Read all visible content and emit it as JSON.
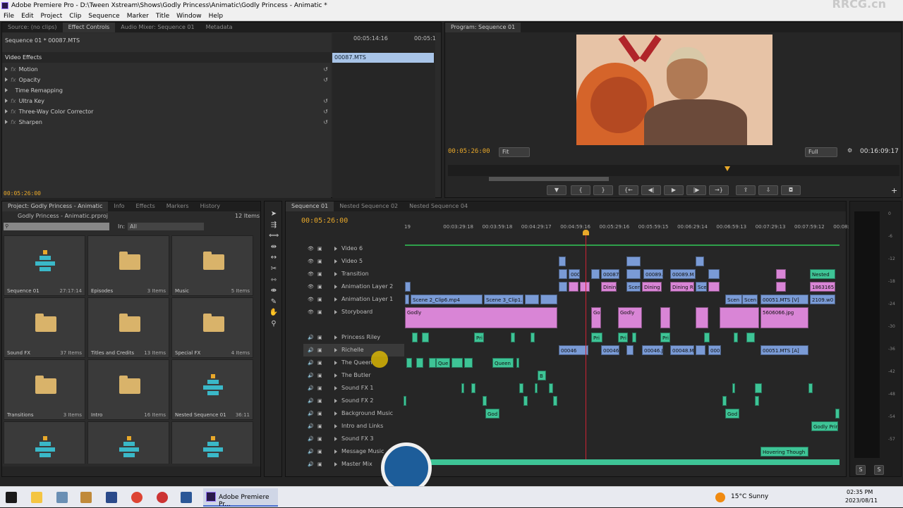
{
  "title": "Adobe Premiere Pro - D:\\Tween Xstream\\Shows\\Godly Princess\\Animatic\\Godly Princess - Animatic *",
  "watermark": "RRCG.cn",
  "menu": [
    "File",
    "Edit",
    "Project",
    "Clip",
    "Sequence",
    "Marker",
    "Title",
    "Window",
    "Help"
  ],
  "source_tabs": [
    "Source: (no clips)",
    "Effect Controls",
    "Audio Mixer: Sequence 01",
    "Metadata"
  ],
  "effect_controls": {
    "header": "Sequence 01 * 00087.MTS",
    "tc1": "00:05:14:16",
    "tc2": "00:05:1",
    "clip": "00087.MTS",
    "section": "Video Effects",
    "effects": [
      "Motion",
      "Opacity",
      "Time Remapping",
      "Ultra Key",
      "Three-Way Color Corrector",
      "Sharpen"
    ],
    "footer_tc": "00:05:26:00"
  },
  "program": {
    "tab": "Program: Sequence 01",
    "tc": "00:05:26:00",
    "fit": "Fit",
    "full": "Full",
    "duration": "00:16:09:17"
  },
  "project": {
    "tabs": [
      "Project: Godly Princess - Animatic",
      "Info",
      "Effects",
      "Markers",
      "History"
    ],
    "file": "Godly Princess - Animatic.prproj",
    "count": "12 Items",
    "in_label": "In:",
    "in_value": "All",
    "items": [
      {
        "name": "Sequence 01",
        "meta": "27:17:14",
        "kind": "seq"
      },
      {
        "name": "Episodes",
        "meta": "3 Items",
        "kind": "folder"
      },
      {
        "name": "Music",
        "meta": "5 Items",
        "kind": "folder"
      },
      {
        "name": "Sound FX",
        "meta": "37 Items",
        "kind": "folder"
      },
      {
        "name": "Titles and Credits",
        "meta": "13 Items",
        "kind": "folder"
      },
      {
        "name": "Special FX",
        "meta": "4 Items",
        "kind": "folder"
      },
      {
        "name": "Transitions",
        "meta": "3 Items",
        "kind": "folder"
      },
      {
        "name": "Intro",
        "meta": "16 Items",
        "kind": "folder"
      },
      {
        "name": "Nested Sequence 01",
        "meta": "36:11",
        "kind": "seq"
      },
      {
        "name": "",
        "meta": "",
        "kind": "seq"
      },
      {
        "name": "",
        "meta": "",
        "kind": "seq"
      },
      {
        "name": "",
        "meta": "",
        "kind": "seq"
      }
    ]
  },
  "timeline": {
    "tabs": [
      "Sequence 01",
      "Nested Sequence 02",
      "Nested Sequence 04"
    ],
    "tc": "00:05:26:00",
    "ruler": [
      "19",
      "00:03:29:18",
      "00:03:59:18",
      "00:04:29:17",
      "00:04:59:16",
      "00:05:29:16",
      "00:05:59:15",
      "00:06:29:14",
      "00:06:59:13",
      "00:07:29:13",
      "00:07:59:12",
      "00:08:29:11"
    ],
    "tracks": [
      "Video 6",
      "Video 5",
      "Transition",
      "Animation Layer 2",
      "Animation Layer 1",
      "Storyboard",
      "Princess Riley",
      "Richelle",
      "The Queen",
      "The Butler",
      "Sound FX 1",
      "Sound FX 2",
      "Background Music",
      "Intro and Links",
      "Sound FX 3",
      "Message Music",
      "Master Mix"
    ],
    "clips": {
      "scene2": "Scene 2_Clip6.mp4",
      "scene3": "Scene 3_Clip1.",
      "godly": "Godly",
      "god": "God",
      "mts_v": "00051.MTS [V]",
      "mts_a": "00051.MTS [A]",
      "nested": "Nested",
      "n1863": "1863165",
      "n2109": "2109.w0",
      "jpg": "5606066.jpg",
      "queen": "Queen",
      "que": "Que",
      "hover": "Hovering Though",
      "godlyprin": "Godly Prin",
      "pri": "Pri",
      "dining": "Dining",
      "dining_r": "Dining R",
      "scen": "Scen",
      "c00087": "00087",
      "c00089": "00089.M",
      "c00046": "00046",
      "c00046j": "00046.J",
      "c00048": "00048.M",
      "c000": "000",
      "b": "B"
    }
  },
  "meter_labels": [
    "0",
    "-6",
    "-12",
    "-18",
    "-24",
    "-30",
    "-36",
    "-42",
    "-48",
    "-54",
    "-57"
  ],
  "taskbar": {
    "app": "Adobe Premiere Pr...",
    "weather": "15°C  Sunny",
    "time": "02:35 PM",
    "date": "2023/08/11"
  },
  "colors": {
    "accent": "#e8a82a",
    "video": "#7a9bd6",
    "pink": "#d985d6",
    "audio": "#3ec496"
  }
}
